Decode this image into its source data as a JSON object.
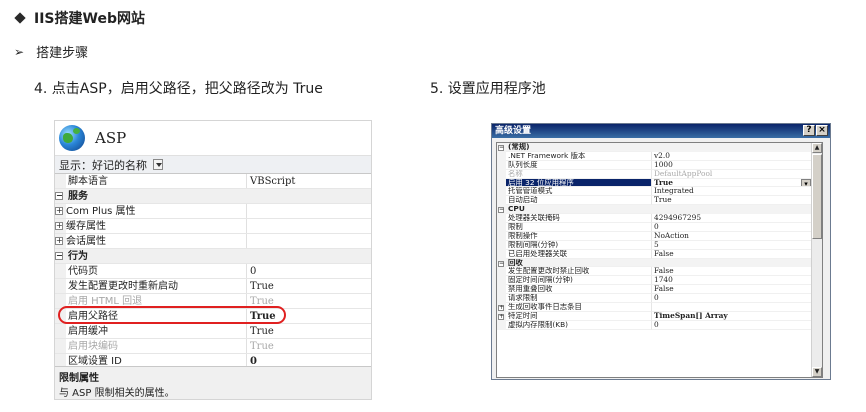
{
  "heading": "IIS搭建Web网站",
  "subheading": "搭建步骤",
  "step4": "4.  点击ASP，启用父路径，把父路径改为 True",
  "step5": "5.  设置应用程序池",
  "asp_panel": {
    "title": "ASP",
    "show_label": "显示：",
    "show_value": "好记的名称",
    "rows": [
      {
        "kind": "item",
        "name": "脚本语言",
        "value": "VBScript"
      },
      {
        "kind": "cat",
        "name": "服务",
        "value": ""
      },
      {
        "kind": "sub",
        "name": "Com Plus 属性",
        "value": ""
      },
      {
        "kind": "sub",
        "name": "缓存属性",
        "value": ""
      },
      {
        "kind": "sub",
        "name": "会话属性",
        "value": ""
      },
      {
        "kind": "cat",
        "name": "行为",
        "value": ""
      },
      {
        "kind": "item",
        "name": "代码页",
        "value": "0"
      },
      {
        "kind": "item",
        "name": "发生配置更改时重新启动",
        "value": "True"
      },
      {
        "kind": "dim",
        "name": "启用 HTML 回退",
        "value": "True"
      },
      {
        "kind": "bold",
        "name": "启用父路径",
        "value": "True"
      },
      {
        "kind": "item",
        "name": "启用缓冲",
        "value": "True"
      },
      {
        "kind": "dim",
        "name": "启用块编码",
        "value": "True"
      },
      {
        "kind": "bold",
        "name": "区域设置 ID",
        "value": "0"
      }
    ],
    "desc_title": "限制属性",
    "desc_text": "与 ASP 限制相关的属性。"
  },
  "dialog": {
    "title": "高级设置",
    "help_btn": "?",
    "close_btn": "×",
    "rows": [
      {
        "kind": "cat",
        "name": "(常规)",
        "value": ""
      },
      {
        "kind": "item",
        "name": ".NET Framework 版本",
        "value": "v2.0"
      },
      {
        "kind": "item",
        "name": "队列长度",
        "value": "1000"
      },
      {
        "kind": "dim",
        "name": "名称",
        "value": "DefaultAppPool"
      },
      {
        "kind": "sel",
        "name": "启用 32 位应用程序",
        "value": "True"
      },
      {
        "kind": "item",
        "name": "托管管道模式",
        "value": "Integrated"
      },
      {
        "kind": "item",
        "name": "自动启动",
        "value": "True"
      },
      {
        "kind": "cat",
        "name": "CPU",
        "value": ""
      },
      {
        "kind": "item",
        "name": "处理器关联掩码",
        "value": "4294967295"
      },
      {
        "kind": "item",
        "name": "限制",
        "value": "0"
      },
      {
        "kind": "item",
        "name": "限制操作",
        "value": "NoAction"
      },
      {
        "kind": "item",
        "name": "限制间隔(分钟)",
        "value": "5"
      },
      {
        "kind": "item",
        "name": "已启用处理器关联",
        "value": "False"
      },
      {
        "kind": "cat",
        "name": "回收",
        "value": ""
      },
      {
        "kind": "item",
        "name": "发生配置更改时禁止回收",
        "value": "False"
      },
      {
        "kind": "item",
        "name": "固定时间间隔(分钟)",
        "value": "1740"
      },
      {
        "kind": "item",
        "name": "禁用重叠回收",
        "value": "False"
      },
      {
        "kind": "item",
        "name": "请求限制",
        "value": "0"
      },
      {
        "kind": "sub",
        "name": "生成回收事件日志条目",
        "value": ""
      },
      {
        "kind": "subbold",
        "name": "特定时间",
        "value": "TimeSpan[] Array"
      },
      {
        "kind": "item",
        "name": "虚拟内存限制(KB)",
        "value": "0"
      }
    ]
  }
}
